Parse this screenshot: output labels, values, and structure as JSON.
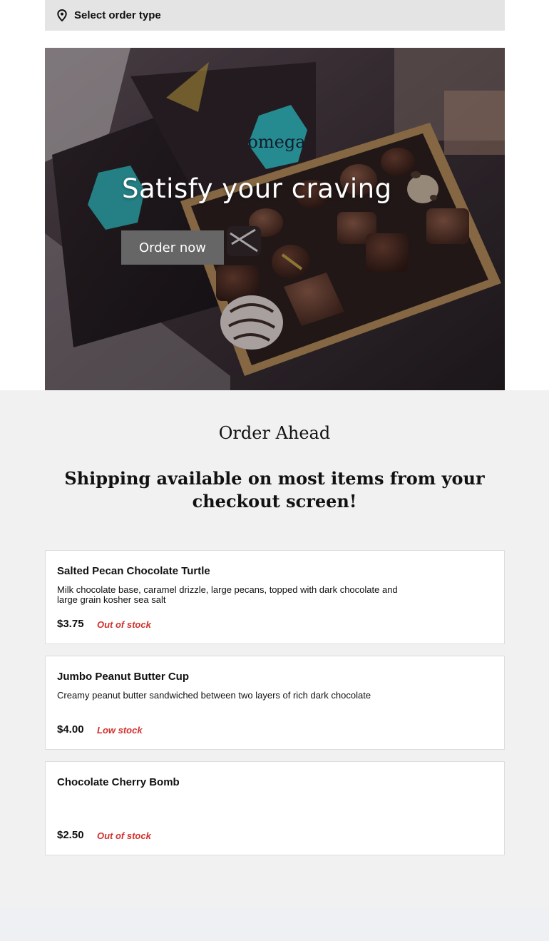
{
  "order_type": {
    "label": "Select order type",
    "icon": "location-pin-icon"
  },
  "hero": {
    "title": "Satisfy your craving",
    "button_label": "Order now",
    "image_brand_text": "omega"
  },
  "menu": {
    "title": "Order Ahead",
    "subtitle": "Shipping available on most items from your checkout screen!",
    "items": [
      {
        "name": "Salted Pecan Chocolate Turtle",
        "description": "Milk chocolate base, caramel drizzle, large pecans, topped with dark chocolate and large grain kosher sea salt",
        "price": "$3.75",
        "stock": "Out of stock"
      },
      {
        "name": "Jumbo Peanut Butter Cup",
        "description": "Creamy peanut butter sandwiched between two layers of rich dark chocolate",
        "price": "$4.00",
        "stock": "Low stock"
      },
      {
        "name": "Chocolate Cherry Bomb",
        "description": "",
        "price": "$2.50",
        "stock": "Out of stock"
      }
    ]
  },
  "colors": {
    "stock_alert": "#d0312d",
    "bar_background": "#e4e4e4",
    "section_background": "#f1f1f1",
    "button_background": "#666666",
    "teal_label": "#2bbcbf"
  }
}
